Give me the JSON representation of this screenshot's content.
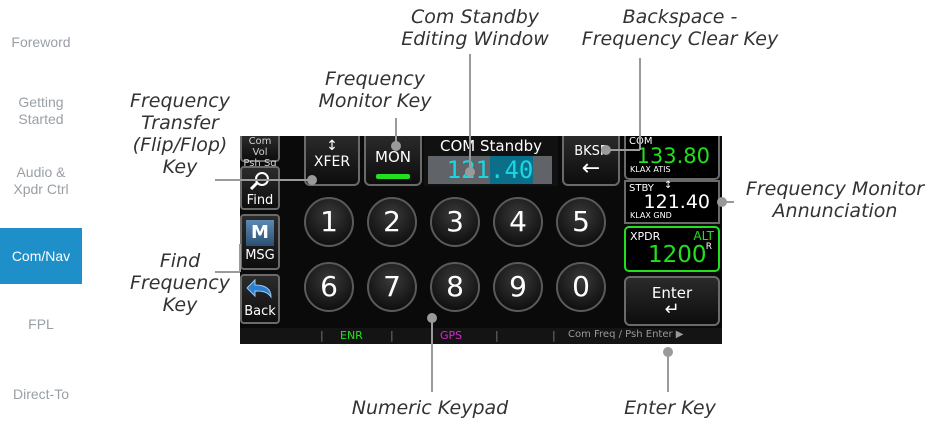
{
  "nav": {
    "items": [
      {
        "label": "Foreword"
      },
      {
        "label": "Getting\nStarted"
      },
      {
        "label": "Audio &\nXpdr Ctrl"
      },
      {
        "label": "Com/Nav"
      },
      {
        "label": "FPL"
      },
      {
        "label": "Direct-To"
      }
    ],
    "active_color": "#1e8fc8"
  },
  "callouts": {
    "com_standby": "Com Standby\nEditing Window",
    "backspace": "Backspace -\nFrequency Clear Key",
    "freq_monitor_key": "Frequency\nMonitor Key",
    "freq_transfer": "Frequency\nTransfer\n(Flip/Flop)\nKey",
    "freq_monitor_ann": "Frequency Monitor\nAnnunciation",
    "find_freq": "Find\nFrequency\nKey",
    "numeric_keypad": "Numeric Keypad",
    "enter_key": "Enter Key"
  },
  "screen": {
    "com_vol": "Com Vol",
    "psh_sq": "Psh Sq",
    "xfer_arrow": "↕",
    "xfer": "XFER",
    "mon": "MON",
    "standby_title": "COM Standby",
    "standby_freq_a": "121",
    "standby_freq_b": ".40",
    "bksp": "BKSP",
    "bksp_arrow": "←",
    "find": "Find",
    "msg": "MSG",
    "back": "Back",
    "enter": "Enter",
    "enter_arrow": "↵",
    "keypad": [
      "1",
      "2",
      "3",
      "4",
      "5",
      "6",
      "7",
      "8",
      "9",
      "0"
    ],
    "com_label": "COM",
    "active_freq": "133.80",
    "active_id": "KLAX ATIS",
    "swap_arrow": "↕",
    "stby_label": "STBY",
    "stby_freq": "121.40",
    "stby_id": "KLAX GND",
    "xpdr_label": "XPDR",
    "xpdr_mode": "ALT",
    "squawk": "1200",
    "squawk_r": "R",
    "status_enr": "ENR",
    "status_gps": "GPS",
    "status_hint": "Com Freq / Psh Enter ▶",
    "colors": {
      "green": "#23e01e",
      "cyan": "#18d8e6",
      "magenta": "#d22ad2"
    }
  }
}
